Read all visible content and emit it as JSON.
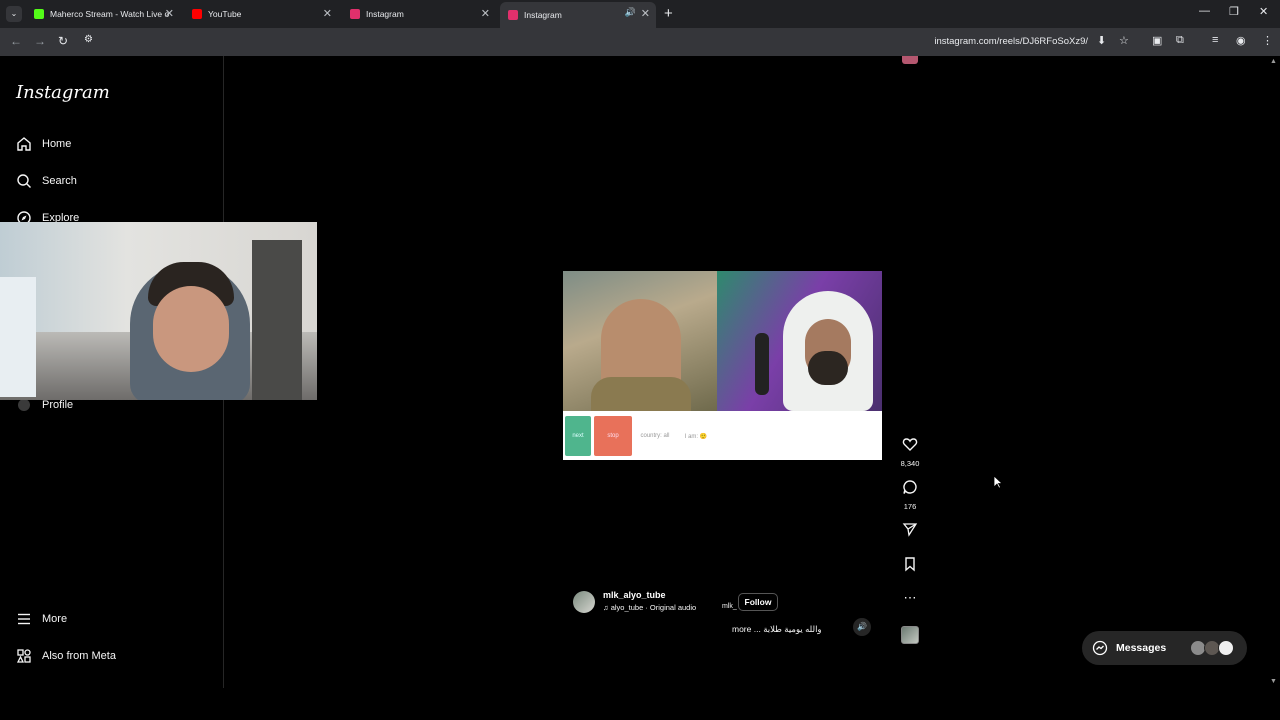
{
  "browser": {
    "tabs": [
      {
        "title": "Maherco Stream - Watch Live o",
        "favicon_color": "#53fc18"
      },
      {
        "title": "YouTube",
        "favicon_color": "#ff0000"
      },
      {
        "title": "Instagram",
        "favicon_color": "#e1306c"
      },
      {
        "title": "Instagram",
        "favicon_color": "#e1306c"
      }
    ],
    "new_tab": "+",
    "url": "instagram.com/reels/DJ6RFoSoXz9/"
  },
  "sidebar": {
    "logo": "Instagram",
    "items": [
      {
        "label": "Home",
        "icon": "home-icon"
      },
      {
        "label": "Search",
        "icon": "search-icon"
      },
      {
        "label": "Explore",
        "icon": "explore-icon"
      },
      {
        "label": "Profile",
        "icon": "profile-icon"
      },
      {
        "label": "More",
        "icon": "menu-icon"
      },
      {
        "label": "Also from Meta",
        "icon": "meta-icon"
      }
    ]
  },
  "reel": {
    "controls": [
      {
        "label": "next",
        "color": "#4fb58d"
      },
      {
        "label": "stop",
        "color": "#e8715a"
      },
      {
        "label": "country: all",
        "color": "#ffffff"
      },
      {
        "label": "I am: 🙂",
        "color": "#ffffff"
      }
    ],
    "likes": "8,340",
    "comments": "176",
    "username": "mlk_alyo_tube",
    "audio": "♫ alyo_tube · Original audio",
    "mlk": "mlk_",
    "follow": "Follow",
    "caption": "more ... والله يومية طلابة"
  },
  "messages": {
    "label": "Messages"
  }
}
